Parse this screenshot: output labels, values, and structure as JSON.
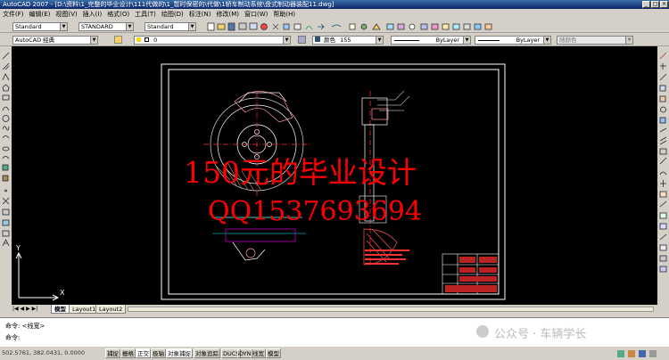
{
  "window": {
    "title": "AutoCAD 2007 - [D:\\资料\\1_完整的毕业设计\\111代做的\\1_暂时保密的\\代做\\1轿车制动系统\\盘式制动器装配11.dwg]",
    "min_label": "_",
    "max_label": "□",
    "close_label": "×"
  },
  "menu": {
    "items": [
      "文件(F)",
      "编辑(E)",
      "视图(V)",
      "插入(I)",
      "格式(O)",
      "工具(T)",
      "绘图(D)",
      "标注(N)",
      "修改(M)",
      "窗口(W)",
      "帮助(H)"
    ]
  },
  "styles_toolbar": {
    "text_style": "Standard",
    "dim_style": "STANDARD",
    "table_style": "Standard"
  },
  "workspace_toolbar": {
    "workspace": "AutoCAD 经典",
    "layer": "0",
    "color_prefix": "颜色",
    "color_value": "155",
    "linetype": "ByLayer",
    "lineweight": "ByLayer",
    "plotstyle": "随颜色"
  },
  "drawing": {
    "overlay_line1": "150元的毕业设计",
    "overlay_line2": "QQ1537693694"
  },
  "layout_tabs": {
    "model": "模型",
    "layout1": "Layout1",
    "layout2": "Layout2"
  },
  "command": {
    "line1": "命令: <线宽>",
    "line2": "命令:"
  },
  "status": {
    "coords": "502.5761, 382.0431, 0.0000",
    "buttons": [
      "捕捉",
      "栅格",
      "正交",
      "极轴",
      "对象捕捉",
      "对象追踪",
      "DUCS",
      "DYN",
      "线宽",
      "模型"
    ]
  },
  "watermark": {
    "text": "公众号 · 车辆学长"
  },
  "colors": {
    "canvas": "#000000",
    "overlay_text": "#ff0000",
    "chrome": "#d4d0c8",
    "titlebar": "#0a246a"
  }
}
